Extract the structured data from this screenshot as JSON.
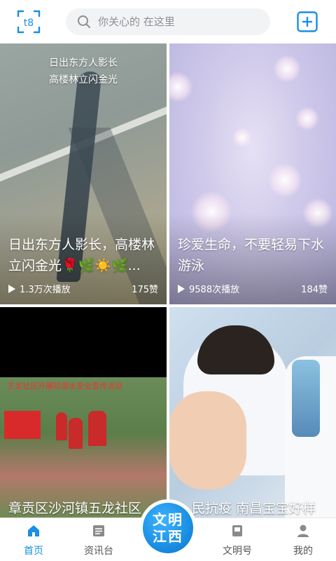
{
  "header": {
    "search_placeholder": "你关心的 在这里"
  },
  "feed": [
    {
      "overlay_line1": "日出东方人影长",
      "overlay_line2": "高楼林立闪金光",
      "title": "日出东方人影长，高楼林立闪金光🌹🌿☀️🌿...",
      "plays": "1.3万次播放",
      "likes": "175赞"
    },
    {
      "title": "珍爱生命，不要轻易下水游泳",
      "plays": "9588次播放",
      "likes": "184赞"
    },
    {
      "banner_text": "五龙社区开展防溺水安全宣传活动",
      "title": "章贡区沙河镇五龙社区"
    },
    {
      "title": "民抗疫 南昌宝宝好样"
    }
  ],
  "tabbar": {
    "items": [
      {
        "label": "首页",
        "active": true
      },
      {
        "label": "资讯台",
        "active": false
      },
      {
        "label": "文明号",
        "active": false
      },
      {
        "label": "我的",
        "active": false
      }
    ],
    "center_line1": "文明",
    "center_line2": "江西"
  },
  "colors": {
    "accent": "#1a8fe3",
    "search_bg": "#f2f3f5"
  }
}
